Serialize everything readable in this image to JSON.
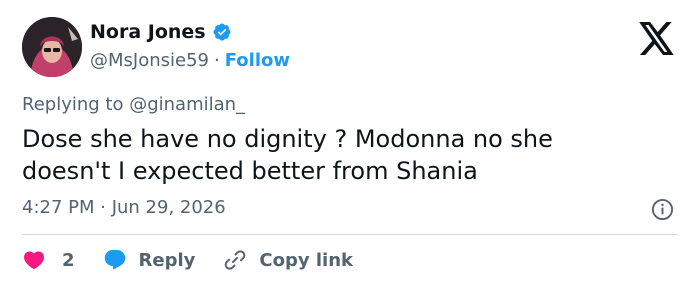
{
  "author": {
    "name": "Nora Jones",
    "handle": "@MsJonsie59",
    "separator": "·",
    "follow_label": "Follow",
    "verified_icon": "verified-badge-icon"
  },
  "reply_context": {
    "prefix": "Replying to ",
    "mention": "@ginamilan_"
  },
  "tweet": {
    "text_line1": "Dose she have no dignity ? Modonna no she",
    "text_line2": "doesn't I expected better from Shania",
    "timestamp": "4:27 PM · Jun 29, 2026"
  },
  "actions": {
    "like_count": "2",
    "reply_label": "Reply",
    "copy_link_label": "Copy link"
  },
  "colors": {
    "accent": "#1d9bf0",
    "like": "#f91880",
    "secondary_text": "#536471",
    "divider": "#cfd9de"
  }
}
